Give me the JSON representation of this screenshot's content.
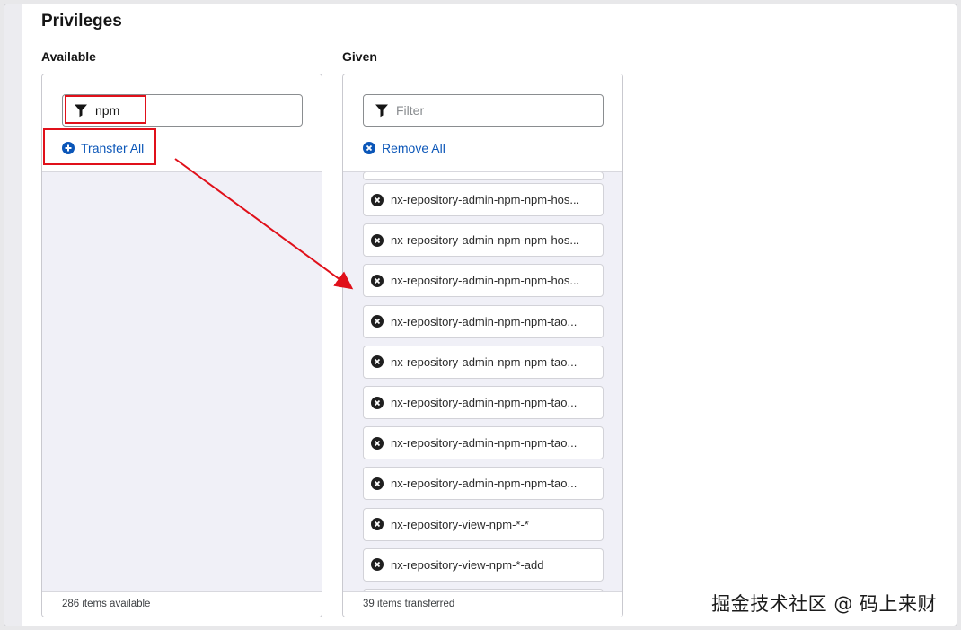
{
  "page": {
    "title": "Privileges",
    "watermark": "掘金技术社区 @ 码上来财"
  },
  "available": {
    "label": "Available",
    "filter_value": "npm",
    "filter_placeholder": "Filter",
    "action_label": "Transfer All",
    "footer": "286 items available"
  },
  "given": {
    "label": "Given",
    "filter_value": "",
    "filter_placeholder": "Filter",
    "action_label": "Remove All",
    "footer": "39 items transferred",
    "items": [
      "nx-repository-admin-npm-npm-hos...",
      "nx-repository-admin-npm-npm-hos...",
      "nx-repository-admin-npm-npm-hos...",
      "nx-repository-admin-npm-npm-tao...",
      "nx-repository-admin-npm-npm-tao...",
      "nx-repository-admin-npm-npm-tao...",
      "nx-repository-admin-npm-npm-tao...",
      "nx-repository-admin-npm-npm-tao...",
      "nx-repository-view-npm-*-*",
      "nx-repository-view-npm-*-add"
    ]
  },
  "icons": {
    "filter": "filter-funnel-icon",
    "transfer": "plus-circle-icon",
    "remove": "times-circle-icon"
  },
  "colors": {
    "link": "#0b56b8",
    "annotation": "#e0101a",
    "list_bg": "#f0f0f7"
  }
}
